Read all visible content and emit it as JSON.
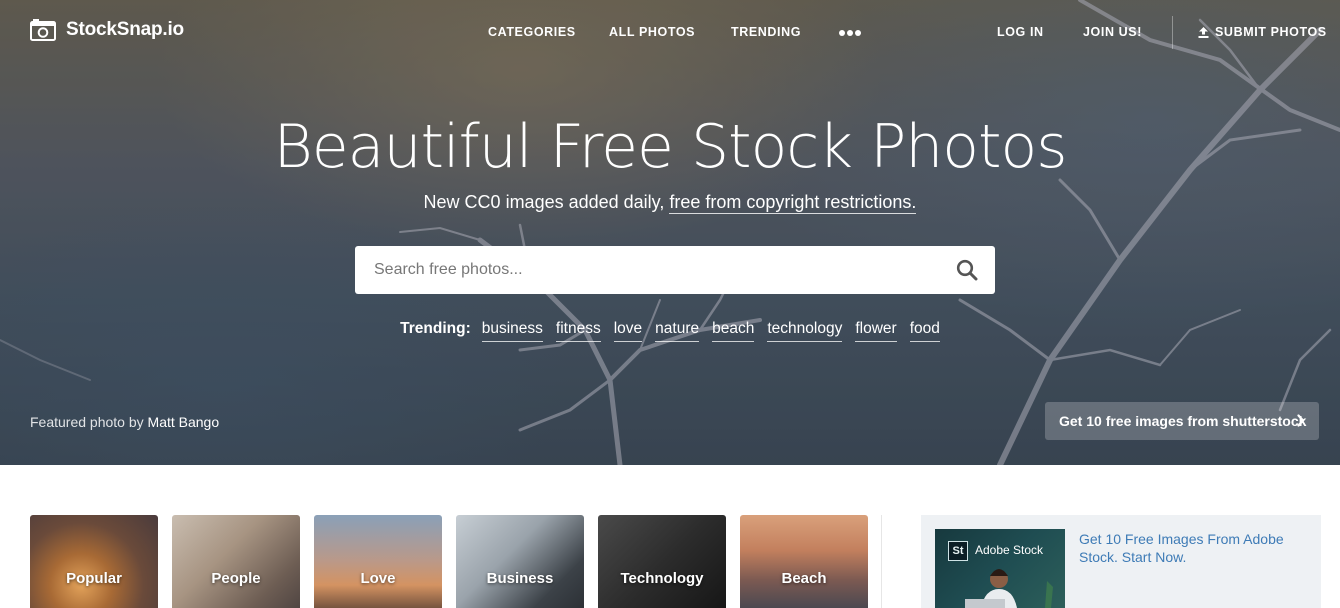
{
  "nav": {
    "logo_text": "StockSnap.io",
    "logo_icon": "camera-icon",
    "links": {
      "categories": "CATEGORIES",
      "all_photos": "ALL PHOTOS",
      "trending": "TRENDING",
      "log_in": "LOG IN",
      "join": "JOIN US!",
      "submit": "SUBMIT PHOTOS"
    },
    "more_icon": "ellipsis-icon",
    "submit_icon": "upload-icon"
  },
  "hero": {
    "title": "Beautiful Free Stock Photos",
    "subtitle_lead": "New CC0 images added daily,",
    "subtitle_link": "free from copyright restrictions.",
    "search_placeholder": "Search free photos...",
    "search_icon": "search-icon",
    "trending_label": "Trending:",
    "trending_tags": [
      "business",
      "fitness",
      "love",
      "nature",
      "beach",
      "technology",
      "flower",
      "food"
    ],
    "featured_prefix": "Featured photo by",
    "featured_author": "Matt Bango",
    "shutter_button": "Get 10 free images from shutterstock",
    "shutter_icon": "chevron-right-icon"
  },
  "categories": [
    {
      "label": "Popular"
    },
    {
      "label": "People"
    },
    {
      "label": "Love"
    },
    {
      "label": "Business"
    },
    {
      "label": "Technology"
    },
    {
      "label": "Beach"
    }
  ],
  "ad": {
    "badge": "St",
    "brand": "Adobe Stock",
    "text": "Get 10 Free Images From Adobe Stock. Start Now."
  },
  "colors": {
    "accent_link": "#3e7bb6",
    "ad_background": "#eef1f4"
  }
}
